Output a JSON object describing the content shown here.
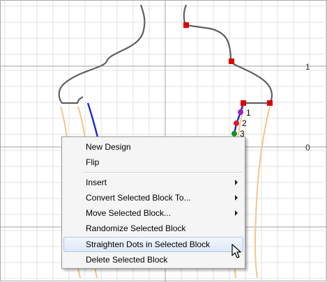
{
  "canvas": {
    "axis_labels": {
      "y_one": "1",
      "y_zero": "0"
    },
    "block_points": [
      {
        "label": "1",
        "color": "#a020c0"
      },
      {
        "label": "2",
        "color": "#d02030"
      },
      {
        "label": "3",
        "color": "#10902a"
      }
    ],
    "colors": {
      "grid": "#e0e0e0",
      "axis": "#a0a0a0",
      "outline": "#606060",
      "pattern": "#f5c58a",
      "selected_line": "#1a28d0",
      "handle": "#e00000"
    }
  },
  "context_menu": {
    "items": [
      {
        "label": "New Design",
        "submenu": false
      },
      {
        "label": "Flip",
        "submenu": false
      },
      {
        "label": "Insert",
        "submenu": true
      },
      {
        "label": "Convert Selected Block To...",
        "submenu": true
      },
      {
        "label": "Move Selected Block...",
        "submenu": true
      },
      {
        "label": "Randomize Selected Block",
        "submenu": false
      },
      {
        "label": "Straighten Dots in Selected Block",
        "submenu": false,
        "highlighted": true
      },
      {
        "label": "Delete Selected Block",
        "submenu": false
      }
    ]
  }
}
